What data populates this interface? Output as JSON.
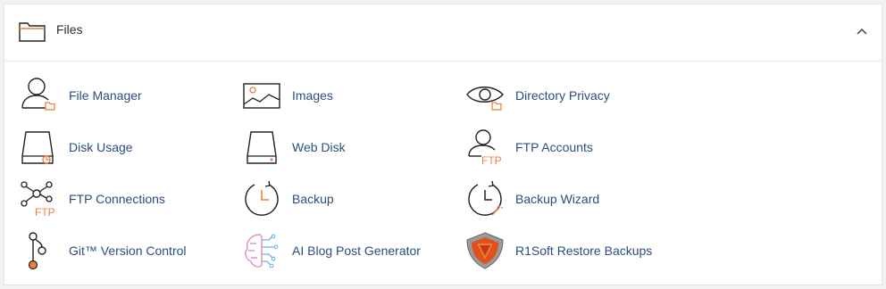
{
  "section": {
    "title": "Files",
    "header_icon": "folder-icon",
    "collapse_icon": "chevron-up-icon"
  },
  "colors": {
    "link": "#2b4d7f",
    "accent": "#f07f3c",
    "icon_stroke": "#222222"
  },
  "items": [
    {
      "label": "File Manager",
      "icon": "file-manager-icon"
    },
    {
      "label": "Images",
      "icon": "images-icon"
    },
    {
      "label": "Directory Privacy",
      "icon": "directory-privacy-icon"
    },
    {
      "label": "Disk Usage",
      "icon": "disk-usage-icon"
    },
    {
      "label": "Web Disk",
      "icon": "web-disk-icon"
    },
    {
      "label": "FTP Accounts",
      "icon": "ftp-accounts-icon",
      "icon_text": "FTP"
    },
    {
      "label": "FTP Connections",
      "icon": "ftp-connections-icon",
      "icon_text": "FTP"
    },
    {
      "label": "Backup",
      "icon": "backup-icon"
    },
    {
      "label": "Backup Wizard",
      "icon": "backup-wizard-icon"
    },
    {
      "label": "Git™ Version Control",
      "icon": "git-icon"
    },
    {
      "label": "AI Blog Post Generator",
      "icon": "ai-blog-icon"
    },
    {
      "label": "R1Soft Restore Backups",
      "icon": "r1soft-icon"
    }
  ]
}
